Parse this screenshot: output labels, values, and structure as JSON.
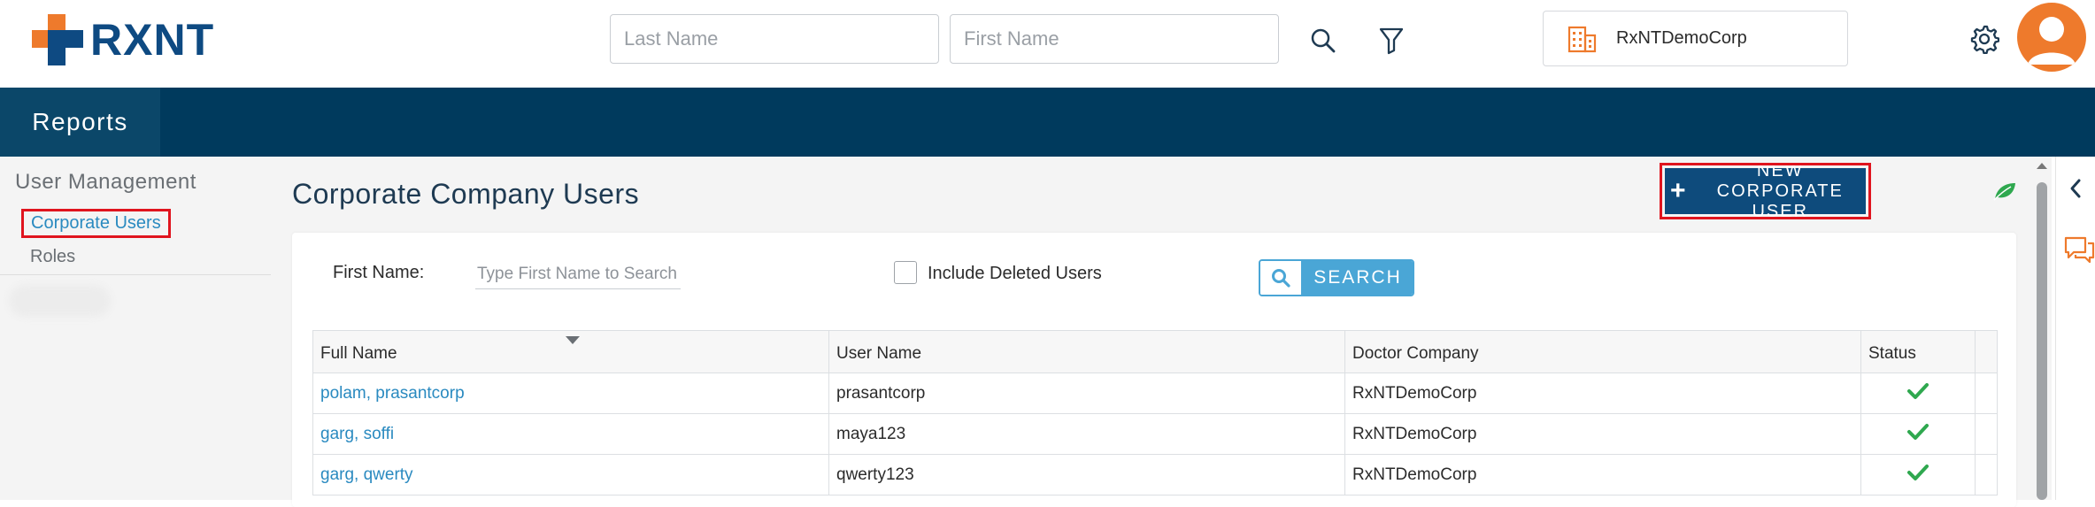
{
  "header": {
    "logo_text": "RXNT",
    "last_name_placeholder": "Last Name",
    "first_name_placeholder": "First Name",
    "company_name": "RxNTDemoCorp",
    "icons": [
      "search-icon",
      "filter-icon",
      "building-icon",
      "gear-icon",
      "user-avatar-icon"
    ]
  },
  "nav": {
    "tabs": [
      {
        "label": "Reports"
      }
    ]
  },
  "sidebar": {
    "title": "User Management",
    "items": [
      {
        "label": "Corporate Users",
        "active": true
      },
      {
        "label": "Roles",
        "active": false
      }
    ]
  },
  "main": {
    "title": "Corporate Company Users",
    "new_user_button": "NEW CORPORATE USER",
    "filter": {
      "first_name_label": "First Name:",
      "first_name_placeholder": "Type First Name to Search",
      "include_deleted_label": "Include Deleted Users",
      "include_deleted_checked": false,
      "search_button": "SEARCH"
    },
    "table": {
      "columns": [
        "Full Name",
        "User Name",
        "Doctor Company",
        "Status"
      ],
      "rows": [
        {
          "full_name": "polam, prasantcorp",
          "user_name": "prasantcorp",
          "company": "RxNTDemoCorp",
          "status": "active"
        },
        {
          "full_name": "garg, soffi",
          "user_name": "maya123",
          "company": "RxNTDemoCorp",
          "status": "active"
        },
        {
          "full_name": "garg, qwerty",
          "user_name": "qwerty123",
          "company": "RxNTDemoCorp",
          "status": "active"
        }
      ]
    }
  },
  "colors": {
    "brand_navy": "#003a5d",
    "brand_orange": "#ee7a2c",
    "link_blue": "#2a8ac0",
    "button_blue": "#0e4b7c",
    "search_blue": "#4aa6d6",
    "highlight_red": "#e0141e",
    "status_green": "#2fa84f"
  }
}
